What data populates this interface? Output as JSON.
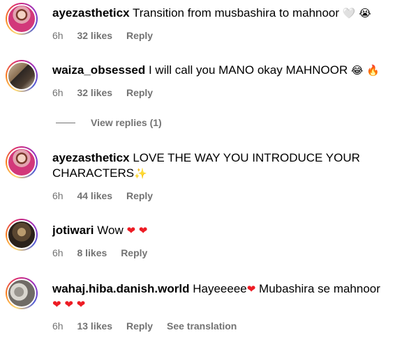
{
  "comments": [
    {
      "username": "ayezastheticx",
      "text": "Transition from musbashira to mahnoor",
      "emojis": "🤍 😭",
      "time": "6h",
      "likes": "32 likes",
      "reply": "Reply"
    },
    {
      "username": "waiza_obsessed",
      "text": "I will call you MANO okay MAHNOOR",
      "emojis": "😂 🔥",
      "time": "6h",
      "likes": "32 likes",
      "reply": "Reply"
    },
    {
      "username": "ayezastheticx",
      "text": "LOVE THE WAY YOU INTRODUCE YOUR CHARACTERS",
      "emojis": "✨",
      "time": "6h",
      "likes": "44 likes",
      "reply": "Reply"
    },
    {
      "username": "jotiwari",
      "text": "Wow",
      "emojis": "❤ ❤",
      "time": "6h",
      "likes": "8 likes",
      "reply": "Reply"
    },
    {
      "username": "wahaj.hiba.danish.world",
      "text": "Hayeeeee",
      "text2": "Mubashira se mahnoor",
      "emojis": "❤",
      "emojis2": "❤ ❤ ❤",
      "time": "6h",
      "likes": "13 likes",
      "reply": "Reply",
      "translation": "See translation"
    }
  ],
  "view_replies": "View replies (1)",
  "colors": {
    "meta": "#737373",
    "heart": "#ed1c24"
  }
}
